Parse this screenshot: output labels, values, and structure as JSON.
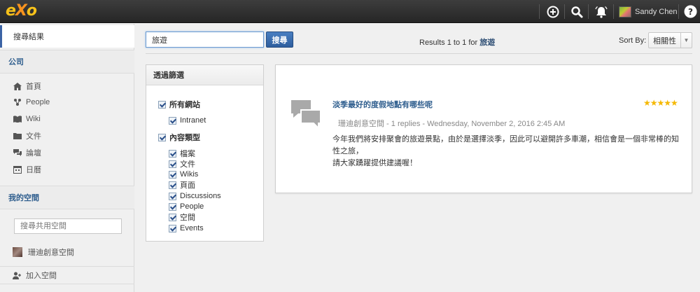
{
  "topbar": {
    "logo": "eXo",
    "user_name": "Sandy Chen",
    "icons": [
      "add-icon",
      "search-icon",
      "notification-bell-icon",
      "help-icon"
    ]
  },
  "sidebar": {
    "active_item": "搜尋結果",
    "company_heading": "公司",
    "company_items": [
      {
        "label": "首頁",
        "icon": "home-icon"
      },
      {
        "label": "People",
        "icon": "people-icon"
      },
      {
        "label": "Wiki",
        "icon": "wiki-icon"
      },
      {
        "label": "文件",
        "icon": "documents-icon"
      },
      {
        "label": "論壇",
        "icon": "forum-icon"
      },
      {
        "label": "日曆",
        "icon": "calendar-icon"
      }
    ],
    "spaces_heading": "我的空間",
    "spaces_search_placeholder": "搜尋共用空間",
    "space_name": "珊迪創意空間",
    "join_label": "加入空間"
  },
  "search": {
    "query": "旅遊",
    "button_label": "搜尋",
    "results_prefix": "Results 1 to 1 for",
    "results_term": "旅遊",
    "sort_label": "Sort By:",
    "sort_value": "相關性"
  },
  "filter": {
    "title": "透過篩選",
    "sites_label": "所有網站",
    "sites": [
      "Intranet"
    ],
    "content_types_label": "內容類型",
    "content_types": [
      "檔案",
      "文件",
      "Wikis",
      "頁面",
      "Discussions",
      "People",
      "空間",
      "Events"
    ]
  },
  "result": {
    "title": "淡季最好的度假地點有哪些呢",
    "rating": "★★★★★",
    "meta": "珊迪創意空間 - 1 replies - Wednesday, November 2, 2016 2:45 AM",
    "excerpt_line1": "今年我們將安排聚會的旅遊景點，由於是選擇淡季，因此可以避開許多車潮，相信會是一個非常棒的知性之旅，",
    "excerpt_line2": "請大家踴躍提供建議喔！"
  },
  "colors": {
    "accent": "#2f5e8e",
    "button": "#3a6fb0",
    "star": "#f5b800",
    "topbar": "#2e2e2e"
  }
}
